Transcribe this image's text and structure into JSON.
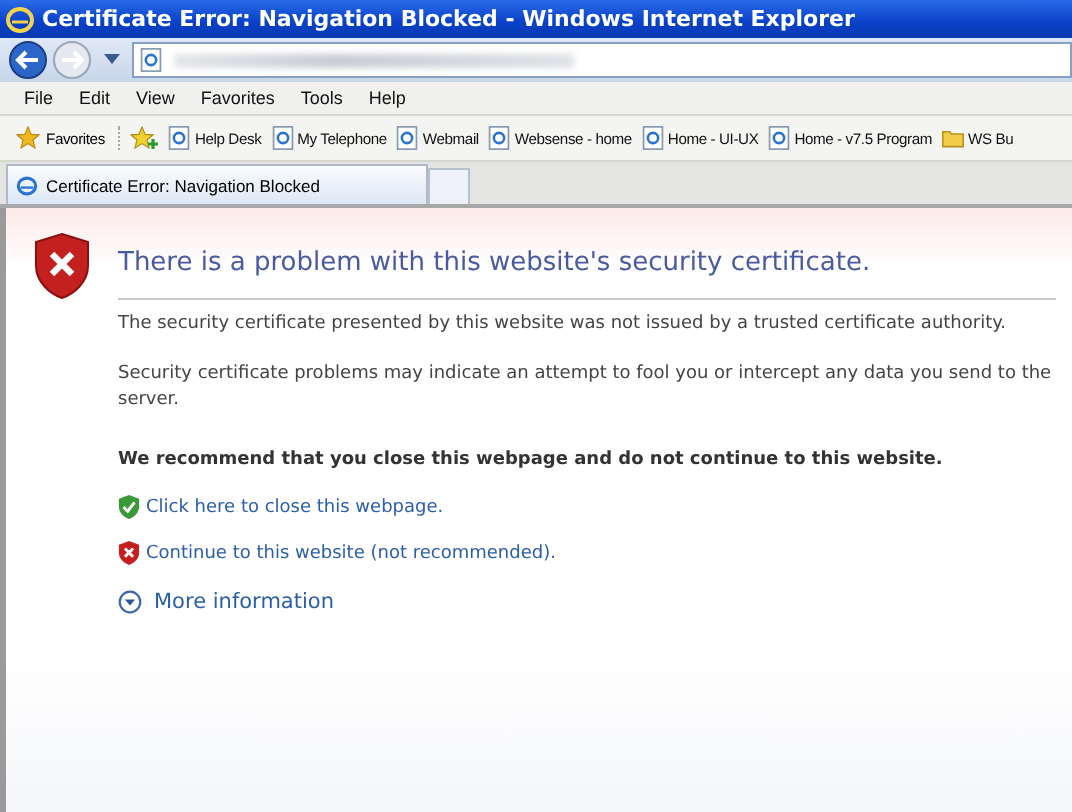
{
  "window": {
    "title": "Certificate Error: Navigation Blocked - Windows Internet Explorer"
  },
  "menu": [
    "File",
    "Edit",
    "View",
    "Favorites",
    "Tools",
    "Help"
  ],
  "favorites_bar": {
    "label": "Favorites",
    "items": [
      {
        "label": "Help Desk",
        "kind": "page"
      },
      {
        "label": "My Telephone",
        "kind": "page"
      },
      {
        "label": "Webmail",
        "kind": "page"
      },
      {
        "label": "Websense - home",
        "kind": "page"
      },
      {
        "label": "Home - UI-UX",
        "kind": "page"
      },
      {
        "label": "Home - v7.5 Program",
        "kind": "page"
      },
      {
        "label": "WS Bu",
        "kind": "folder"
      }
    ]
  },
  "tabs": [
    {
      "label": "Certificate Error: Navigation Blocked",
      "selected": true
    }
  ],
  "page": {
    "heading": "There is a problem with this website's security certificate.",
    "paragraphs": [
      "The security certificate presented by this website was not issued by a trusted certificate authority.",
      "Security certificate problems may indicate an attempt to fool you or intercept any data you send to the server."
    ],
    "recommendation": "We recommend that you close this webpage and do not continue to this website.",
    "links": [
      {
        "label": "Click here to close this webpage.",
        "kind": "safe"
      },
      {
        "label": "Continue to this website (not recommended).",
        "kind": "unsafe"
      }
    ],
    "more_info": {
      "label": "More information",
      "expanded": false
    }
  }
}
